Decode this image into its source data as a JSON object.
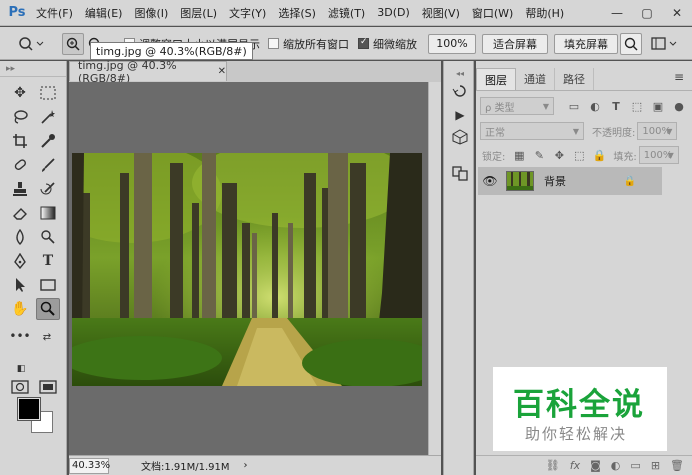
{
  "app": {
    "logo": "Ps"
  },
  "menu": [
    "文件(F)",
    "编辑(E)",
    "图像(I)",
    "图层(L)",
    "文字(Y)",
    "选择(S)",
    "滤镜(T)",
    "3D(D)",
    "视图(V)",
    "窗口(W)",
    "帮助(H)"
  ],
  "window_controls": {
    "minimize": "—",
    "restore": "▢",
    "close": "✕"
  },
  "options": {
    "resize_window_label": "调整窗口大小以满屏显示",
    "zoom_all_windows_label": "缩放所有窗口",
    "scrubby_zoom_label": "细微缩放",
    "scrubby_zoom_checked": true,
    "zoom_100_label": "100%",
    "fit_screen_label": "适合屏幕",
    "fill_screen_label": "填充屏幕"
  },
  "tooltip": "timg.jpg @ 40.3%(RGB/8#)",
  "document": {
    "tab_title": "timg.jpg @ 40.3%(RGB/8#)",
    "tab_close": "✕",
    "zoom_value": "40.33%",
    "doc_info": "文档:1.91M/1.91M",
    "status_arrow": "›"
  },
  "tools_header": "▸▸",
  "tools_more": "•••",
  "layers_panel": {
    "tabs": [
      "图层",
      "通道",
      "路径"
    ],
    "kind_filter": "ρ 类型",
    "blend_mode": "正常",
    "opacity_label": "不透明度:",
    "opacity_value": "100%",
    "lock_label": "锁定:",
    "fill_label": "填充:",
    "fill_value": "100%",
    "layers": [
      {
        "name": "背景",
        "visible": true,
        "locked": true
      }
    ],
    "bottom_icons": [
      "link-icon",
      "fx-icon",
      "mask-icon",
      "adjustment-icon",
      "group-icon",
      "new-layer-icon",
      "trash-icon"
    ],
    "fx_label": "fx"
  },
  "watermark": {
    "title": "百科全说",
    "subtitle": "助你轻松解决"
  },
  "colors": {
    "foreground": "#000000",
    "background": "#ffffff",
    "watermark_green": "#1aa33a",
    "ps_blue": "#2b6fb8"
  }
}
